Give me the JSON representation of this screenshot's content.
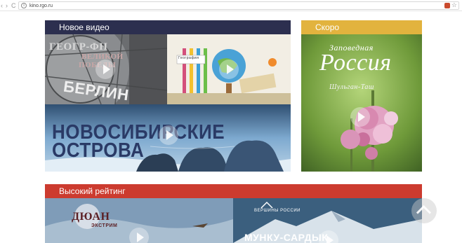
{
  "browser": {
    "url": "kino.rgo.ru",
    "info_glyph": "i",
    "star_glyph": "☆",
    "back_glyph": "‹",
    "forward_glyph": "›",
    "reload_glyph": "C"
  },
  "new_video": {
    "title": "Новое видео",
    "header_color": "#2c2f4f",
    "tiles": [
      {
        "title_line1": "ГЕОГР-ФН",
        "title_line2": "ВЕЛИКОЙ",
        "title_line3": "ПОБЕДЫ",
        "title_line4": "БЕРЛИН"
      },
      {
        "title": "География"
      },
      {
        "title_line1": "НОВОСИБИРСКИЕ",
        "title_line2": "ОСТРОВА"
      }
    ]
  },
  "coming_soon": {
    "title": "Скоро",
    "header_color": "#e2b33e",
    "tile": {
      "title_line1": "Заповедная",
      "title_line2": "Россия",
      "subtitle": "Шульган-Таш"
    }
  },
  "top_rated": {
    "title": "Высокий рейтинг",
    "header_color": "#cc3b2f",
    "tiles": [
      {
        "title": "ДЮАН",
        "subtitle": "ЭКСТРИМ"
      },
      {
        "label": "ВЕРШИНЫ РОССИИ",
        "title": "МУНКУ-САРДЫК"
      }
    ]
  }
}
